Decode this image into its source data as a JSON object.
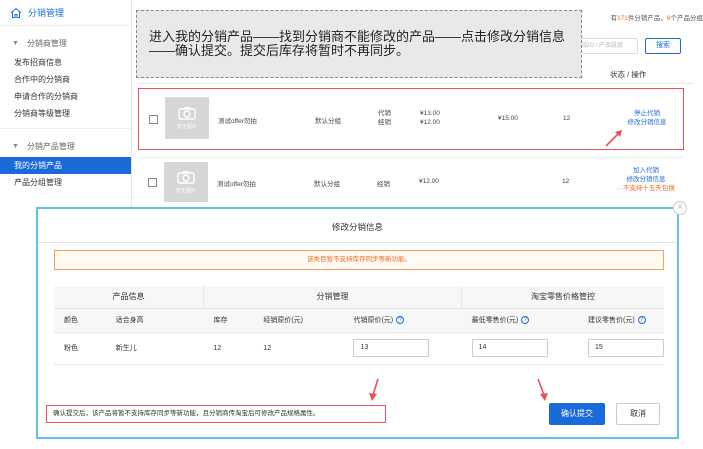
{
  "sidebar": {
    "title": "分销管理",
    "groups": [
      {
        "label": "分销商管理",
        "items": [
          "发布招商信息",
          "合作中的分销商",
          "申请合作的分销商",
          "分销商等级管理"
        ]
      },
      {
        "label": "分销产品管理",
        "items": [
          "我的分销产品",
          "产品分组管理"
        ]
      }
    ],
    "active_item": "我的分销产品"
  },
  "header": {
    "summary_prefix": "有",
    "summary_count": "171",
    "summary_mid": "件分销产品，",
    "summary_groups": "8",
    "summary_suffix": "个产品分组",
    "search_placeholder": "品ID / 产品链接",
    "search_label": "搜索",
    "status_header": "状态 / 操作"
  },
  "callout": {
    "text": "进入我的分销产品——找到分销商不能修改的产品——点击修改分销信息——确认提交。提交后库存将暂时不再同步。"
  },
  "products": [
    {
      "thumb_caption": "暂无图片",
      "name": "测试offer勿拍",
      "group": "默认分组",
      "mode_1": "代销",
      "mode_2": "经销",
      "price_1": "¥13.00",
      "price_2": "¥12.00",
      "retail": "¥15.00",
      "stock": "12",
      "action_1": "停止代销",
      "action_2": "修改分销信息"
    },
    {
      "thumb_caption": "暂无图片",
      "name": "测试offer勿拍",
      "group": "默认分组",
      "mode_1": "经销",
      "price_1": "¥12.00",
      "stock": "12",
      "action_1": "加入代销",
      "action_2": "修改分销信息",
      "note": "不支持十五天包换"
    }
  ],
  "dialog": {
    "title": "修改分销信息",
    "warning": "该类目暂不支持库存同步等新功能。",
    "group_headers": [
      "产品信息",
      "分销管理",
      "淘宝零售价格管控"
    ],
    "columns": [
      "颜色",
      "适合身高",
      "库存",
      "经销原价(元)",
      "代销原价(元)",
      "最低零售价(元)",
      "建议零售价(元)"
    ],
    "row": {
      "color": "粉色",
      "height": "新生儿",
      "stock": "12",
      "dist_price": "12",
      "consign_price": "13",
      "min_retail": "14",
      "suggest_retail": "15"
    },
    "footer_note": "确认提交后，该产品将暂不支持库存同步等新功能，且分销商传淘宝后可修改产品规格属性。",
    "confirm_label": "确认提交",
    "cancel_label": "取消",
    "close_label": "×"
  },
  "colors": {
    "accent": "#1b6ad9",
    "warn": "#f26b1d",
    "highlight": "#e8505b",
    "dialog_border": "#5bc3ec"
  }
}
